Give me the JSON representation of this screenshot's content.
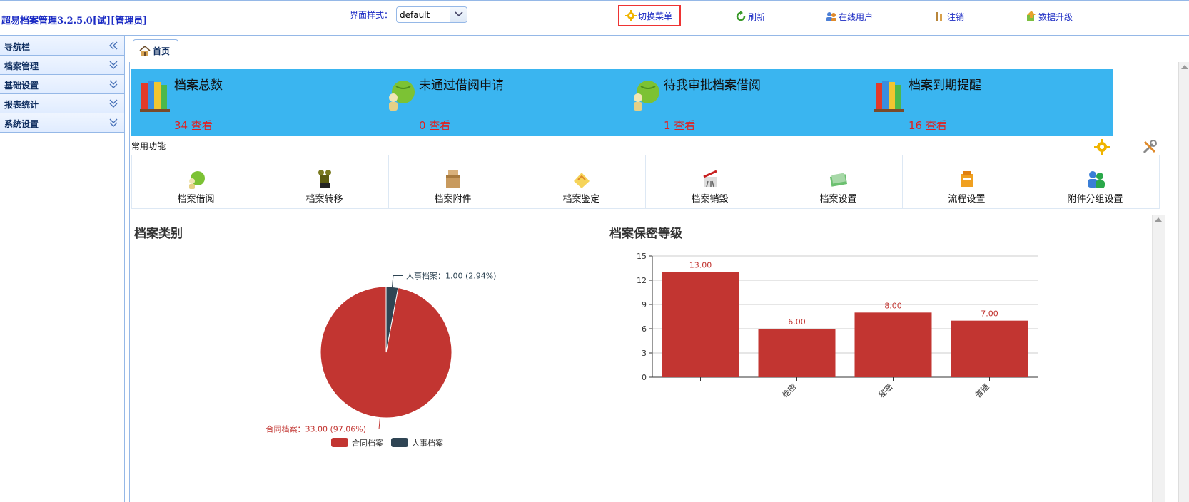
{
  "header": {
    "app_title": "超易档案管理3.2.5.0[试][管理员]",
    "style_label": "界面样式：",
    "style_value": "default",
    "links": [
      {
        "label": "切换菜单",
        "icon": "gear-icon"
      },
      {
        "label": "刷新",
        "icon": "refresh-icon"
      },
      {
        "label": "在线用户",
        "icon": "users-icon"
      },
      {
        "label": "注销",
        "icon": "logout-icon"
      },
      {
        "label": "数据升级",
        "icon": "upgrade-icon"
      }
    ]
  },
  "sidebar": {
    "items": [
      {
        "label": "导航栏"
      },
      {
        "label": "档案管理"
      },
      {
        "label": "基础设置"
      },
      {
        "label": "报表统计"
      },
      {
        "label": "系统设置"
      }
    ]
  },
  "tabs": [
    {
      "label": "首页",
      "icon": "home-icon"
    }
  ],
  "stats": [
    {
      "title": "档案总数",
      "count": "34 查看",
      "icon": "books-icon"
    },
    {
      "title": "未通过借阅申请",
      "count": "0 查看",
      "icon": "globe-person-icon"
    },
    {
      "title": "待我审批档案借阅",
      "count": "1 查看",
      "icon": "globe-person-icon"
    },
    {
      "title": "档案到期提醒",
      "count": "16 查看",
      "icon": "books-icon"
    }
  ],
  "common": {
    "title": "常用功能",
    "items": [
      {
        "label": "档案借阅",
        "icon": "borrow-icon"
      },
      {
        "label": "档案转移",
        "icon": "transfer-icon"
      },
      {
        "label": "档案附件",
        "icon": "attachment-box-icon"
      },
      {
        "label": "档案鉴定",
        "icon": "appraisal-icon"
      },
      {
        "label": "档案销毁",
        "icon": "destroy-icon"
      },
      {
        "label": "档案设置",
        "icon": "settings-book-icon"
      },
      {
        "label": "流程设置",
        "icon": "workflow-icon"
      },
      {
        "label": "附件分组设置",
        "icon": "group-users-icon"
      }
    ]
  },
  "colors": {
    "accent": "#3ab5f0",
    "chart_red": "#c23531",
    "chart_dark": "#2f4554",
    "link_blue": "#1b2bc4",
    "border": "#95b8e7"
  },
  "chart_data": [
    {
      "type": "pie",
      "title": "档案类别",
      "slices": [
        {
          "name": "合同档案",
          "value": 33.0,
          "percent": 97.06,
          "label": "合同档案：33.00 (97.06%)"
        },
        {
          "name": "人事档案",
          "value": 1.0,
          "percent": 2.94,
          "label": "人事档案：1.00 (2.94%)"
        }
      ],
      "legend": [
        "合同档案",
        "人事档案"
      ],
      "legend_position": "bottom-center"
    },
    {
      "type": "bar",
      "title": "档案保密等级",
      "categories": [
        "",
        "绝密",
        "秘密",
        "普通"
      ],
      "values": [
        13.0,
        6.0,
        8.0,
        7.0
      ],
      "value_labels": [
        "13.00",
        "6.00",
        "8.00",
        "7.00"
      ],
      "ylim": [
        0,
        15
      ],
      "yticks": [
        "0",
        "3",
        "6",
        "9",
        "12",
        "15"
      ],
      "grid": true
    }
  ]
}
